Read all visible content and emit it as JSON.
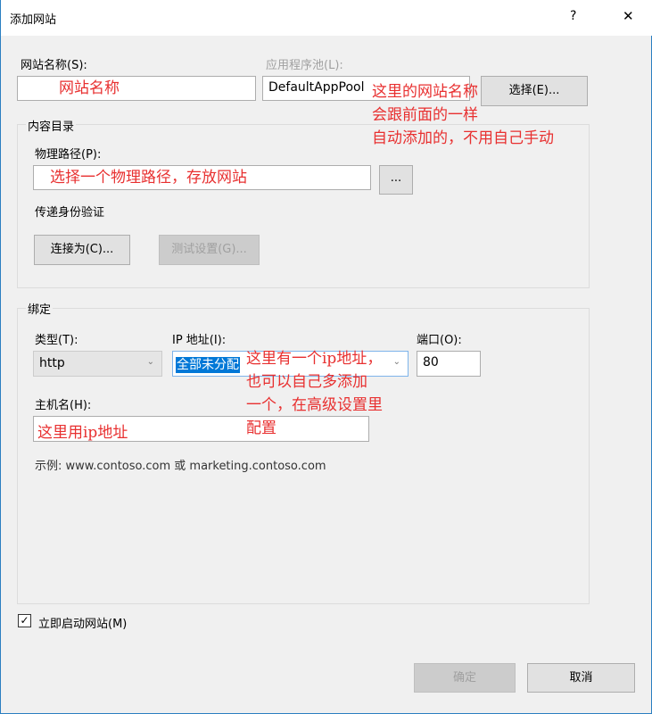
{
  "window": {
    "title": "添加网站",
    "help": "?",
    "close": "✕"
  },
  "site_name": {
    "label": "网站名称(S):",
    "value": "网站名称"
  },
  "app_pool": {
    "label": "应用程序池(L):",
    "value": "DefaultAppPool",
    "select_button": "选择(E)..."
  },
  "annotation_pool": [
    "这里的网站名称",
    "会跟前面的一样",
    "自动添加的，不用自己手动"
  ],
  "content_dir": {
    "title": "内容目录",
    "path_label": "物理路径(P):",
    "path_value": "选择一个物理路径，存放网站",
    "browse": "...",
    "auth_label": "传递身份验证",
    "connect_as": "连接为(C)...",
    "test_settings": "测试设置(G)..."
  },
  "binding": {
    "title": "绑定",
    "type_label": "类型(T):",
    "type_value": "http",
    "ip_label": "IP 地址(I):",
    "ip_value": "全部未分配",
    "port_label": "端口(O):",
    "port_value": "80",
    "host_label": "主机名(H):",
    "host_value": "这里用ip地址",
    "example": "示例: www.contoso.com 或 marketing.contoso.com"
  },
  "annotation_ip": [
    "这里有一个ip地址，",
    "也可以自己多添加",
    "一个，在高级设置里",
    "配置"
  ],
  "start_now": {
    "label": "立即启动网站(M)",
    "checked": true
  },
  "footer": {
    "ok": "确定",
    "cancel": "取消"
  }
}
